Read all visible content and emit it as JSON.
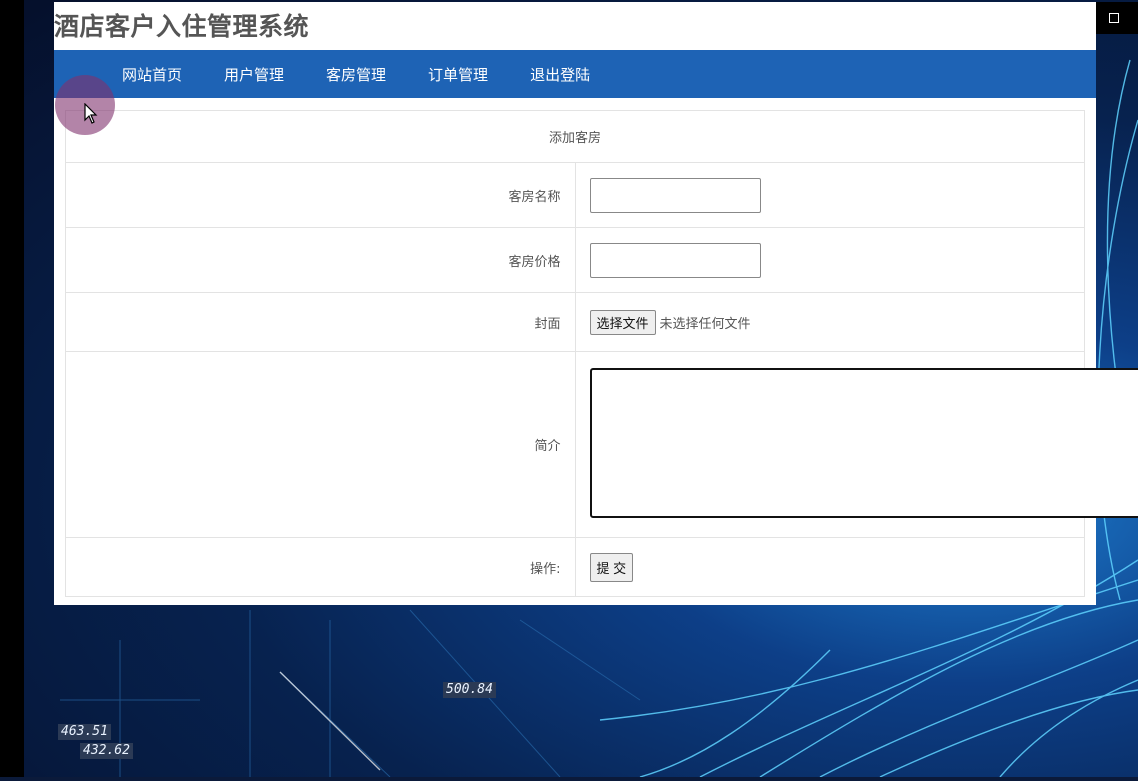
{
  "site": {
    "title": "酒店客户入住管理系统"
  },
  "nav": [
    {
      "label": "网站首页"
    },
    {
      "label": "用户管理"
    },
    {
      "label": "客房管理"
    },
    {
      "label": "订单管理"
    },
    {
      "label": "退出登陆"
    }
  ],
  "form": {
    "header": "添加客房",
    "name_label": "客房名称",
    "name_value": "",
    "price_label": "客房价格",
    "price_value": "",
    "cover_label": "封面",
    "file_button": "选择文件",
    "file_status": "未选择任何文件",
    "intro_label": "简介",
    "intro_value": "",
    "action_label": "操作:",
    "submit_label": "提 交"
  },
  "wallpaper": {
    "numbers": [
      "500.84",
      "463.51",
      "432.62"
    ]
  },
  "icons": [
    "minimize-icon",
    "maximize-icon",
    "mouse-pointer-icon"
  ]
}
